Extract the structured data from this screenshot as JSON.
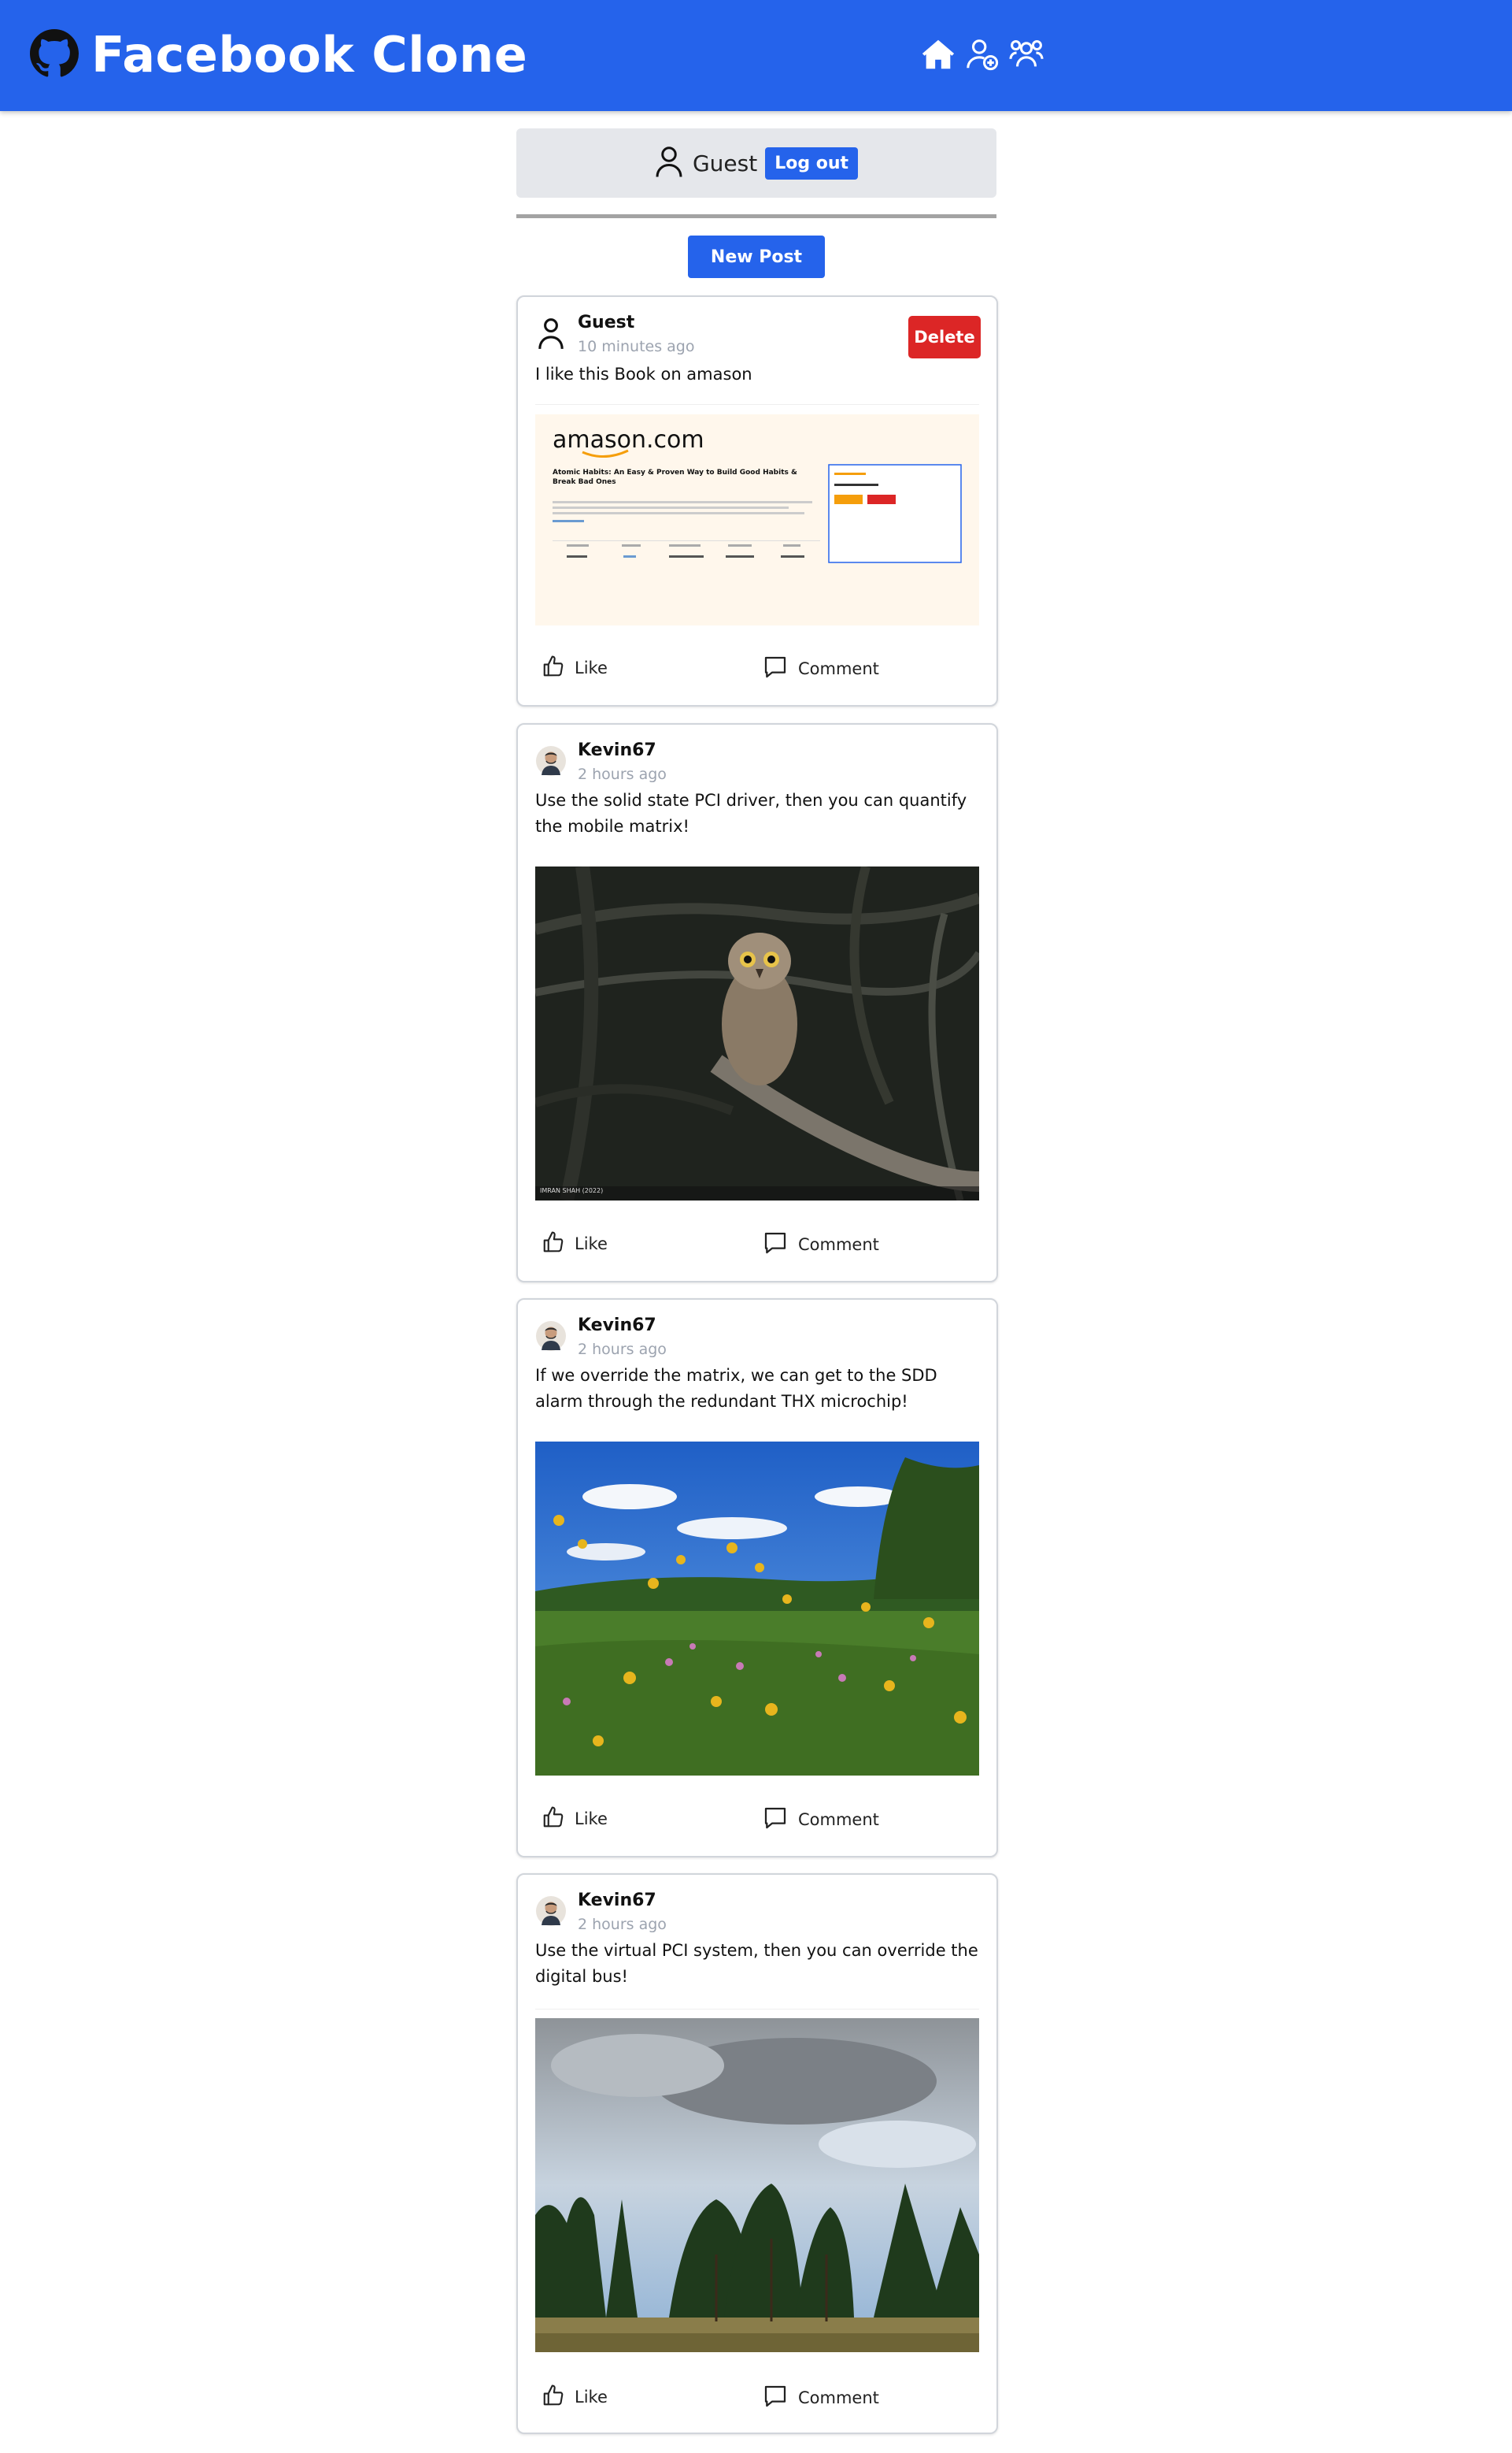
{
  "navbar": {
    "title": "Facebook Clone",
    "brand_icon": "github-icon",
    "icons": [
      "home-icon",
      "add-user-icon",
      "users-icon"
    ],
    "color": "#2563eb"
  },
  "user_bar": {
    "name": "Guest",
    "logout_label": "Log out"
  },
  "new_post_label": "New Post",
  "post_actions": {
    "like_label": "Like",
    "comment_label": "Comment"
  },
  "posts": [
    {
      "author": "Guest",
      "time": "10 minutes ago",
      "text": "I like this Book on amason",
      "delete_label": "Delete",
      "image": {
        "kind": "screenshot",
        "logo": "amason.com",
        "book_title": "Atomic Habits: An Easy & Proven Way to Build Good Habits & Break Bad Ones"
      }
    },
    {
      "author": "Kevin67",
      "time": "2 hours ago",
      "text": "Use the solid state PCI driver, then you can quantify the mobile matrix!",
      "image": {
        "kind": "photo",
        "subject": "owl",
        "caption": "IMRAN SHAH (2022)"
      }
    },
    {
      "author": "Kevin67",
      "time": "2 hours ago",
      "text": "If we override the matrix, we can get to the SDD alarm through the redundant THX microchip!",
      "image": {
        "kind": "photo",
        "subject": "wildflower meadow"
      }
    },
    {
      "author": "Kevin67",
      "time": "2 hours ago",
      "text": "Use the virtual PCI system, then you can override the digital bus!",
      "image": {
        "kind": "photo",
        "subject": "pine trees under clouds"
      }
    }
  ]
}
